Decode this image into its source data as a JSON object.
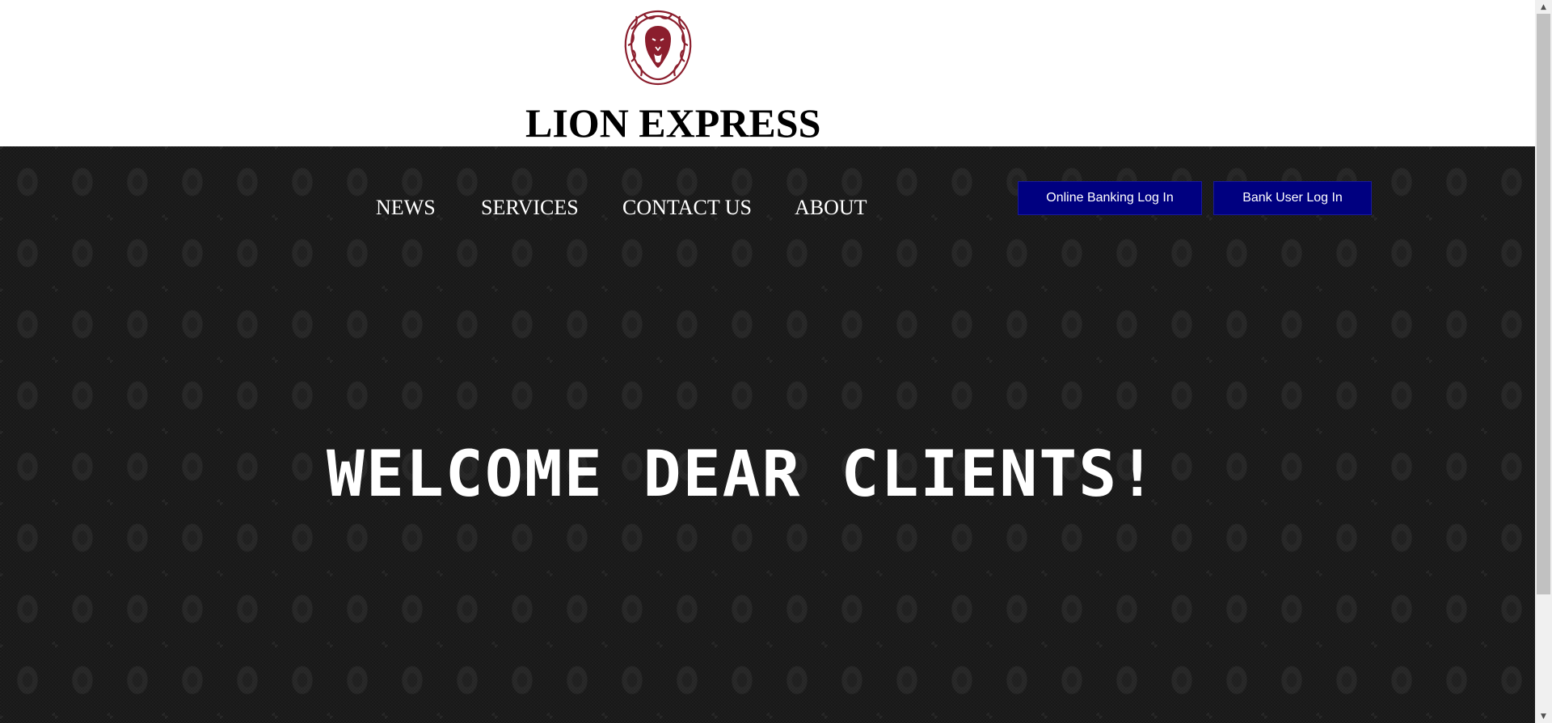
{
  "header": {
    "brand_title": "LION EXPRESS",
    "logo_icon": "lion-head-icon",
    "logo_color": "#8b1e2d"
  },
  "nav": {
    "items": [
      {
        "label": "NEWS"
      },
      {
        "label": "SERVICES"
      },
      {
        "label": "CONTACT US"
      },
      {
        "label": "ABOUT"
      }
    ]
  },
  "actions": {
    "online_banking_label": "Online Banking Log In",
    "bank_user_label": "Bank User Log In",
    "button_color": "#000080"
  },
  "hero": {
    "headline": "WELCOME DEAR CLIENTS!",
    "background_color": "#1b1b1b"
  },
  "scrollbar": {
    "up_icon": "scroll-up-arrow-icon",
    "down_icon": "scroll-down-arrow-icon"
  }
}
